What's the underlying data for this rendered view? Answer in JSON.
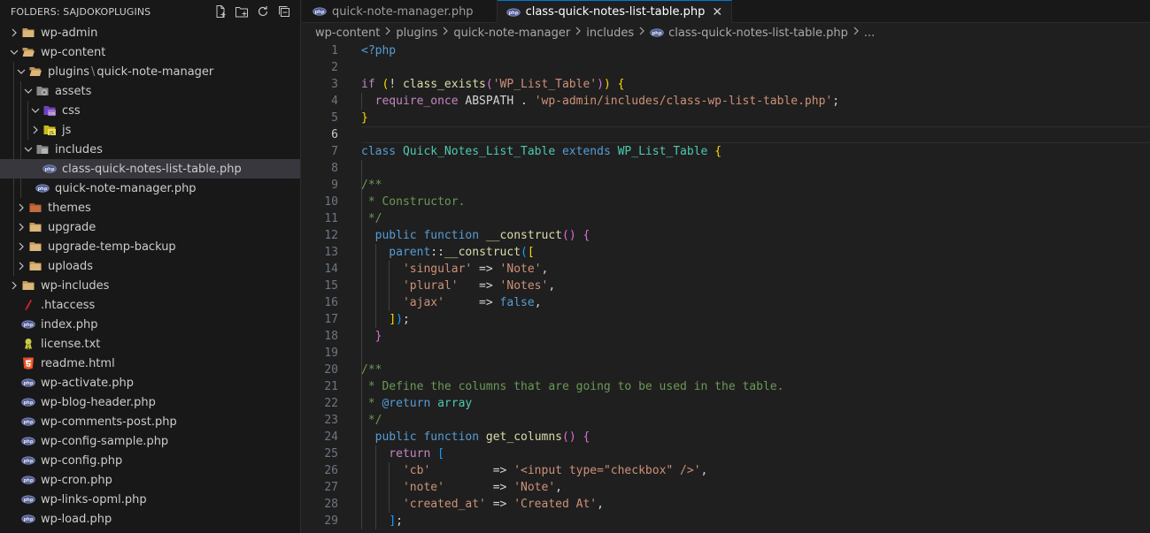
{
  "sidebar": {
    "title": "FOLDERS: SAJDOKOPLUGINS",
    "actions": [
      "new-file-icon",
      "new-folder-icon",
      "refresh-icon",
      "collapse-all-icon"
    ],
    "tree": [
      {
        "label": "wp-admin",
        "depth": 0,
        "type": "folder",
        "expanded": false,
        "icon": "folder-icon"
      },
      {
        "label": "wp-content",
        "depth": 0,
        "type": "folder",
        "expanded": true,
        "icon": "folder-open-icon"
      },
      {
        "label": "plugins",
        "label2": "quick-note-manager",
        "depth": 1,
        "type": "folder",
        "expanded": true,
        "icon": "folder-open-icon"
      },
      {
        "label": "assets",
        "depth": 2,
        "type": "folder",
        "expanded": true,
        "icon": "assets-folder-icon"
      },
      {
        "label": "css",
        "depth": 3,
        "type": "folder",
        "expanded": true,
        "icon": "css-folder-icon"
      },
      {
        "label": "js",
        "depth": 3,
        "type": "folder",
        "expanded": false,
        "icon": "js-folder-icon"
      },
      {
        "label": "includes",
        "depth": 2,
        "type": "folder",
        "expanded": true,
        "icon": "includes-folder-icon"
      },
      {
        "label": "class-quick-notes-list-table.php",
        "depth": 3,
        "type": "php",
        "selected": true,
        "icon": "php-file-icon"
      },
      {
        "label": "quick-note-manager.php",
        "depth": 2,
        "type": "php",
        "icon": "php-file-icon"
      },
      {
        "label": "themes",
        "depth": 1,
        "type": "folder",
        "expanded": false,
        "icon": "themes-folder-icon"
      },
      {
        "label": "upgrade",
        "depth": 1,
        "type": "folder",
        "expanded": false,
        "icon": "folder-icon"
      },
      {
        "label": "upgrade-temp-backup",
        "depth": 1,
        "type": "folder",
        "expanded": false,
        "icon": "folder-icon"
      },
      {
        "label": "uploads",
        "depth": 1,
        "type": "folder",
        "expanded": false,
        "icon": "folder-icon"
      },
      {
        "label": "wp-includes",
        "depth": 0,
        "type": "folder",
        "expanded": false,
        "icon": "folder-icon"
      },
      {
        "label": ".htaccess",
        "depth": 0,
        "type": "htaccess",
        "icon": "htaccess-icon"
      },
      {
        "label": "index.php",
        "depth": 0,
        "type": "php",
        "icon": "php-file-icon"
      },
      {
        "label": "license.txt",
        "depth": 0,
        "type": "txt",
        "icon": "license-icon"
      },
      {
        "label": "readme.html",
        "depth": 0,
        "type": "html",
        "icon": "html5-icon"
      },
      {
        "label": "wp-activate.php",
        "depth": 0,
        "type": "php",
        "icon": "php-file-icon"
      },
      {
        "label": "wp-blog-header.php",
        "depth": 0,
        "type": "php",
        "icon": "php-file-icon"
      },
      {
        "label": "wp-comments-post.php",
        "depth": 0,
        "type": "php",
        "icon": "php-file-icon"
      },
      {
        "label": "wp-config-sample.php",
        "depth": 0,
        "type": "php",
        "icon": "php-file-icon"
      },
      {
        "label": "wp-config.php",
        "depth": 0,
        "type": "php",
        "icon": "php-file-icon"
      },
      {
        "label": "wp-cron.php",
        "depth": 0,
        "type": "php",
        "icon": "php-file-icon"
      },
      {
        "label": "wp-links-opml.php",
        "depth": 0,
        "type": "php",
        "icon": "php-file-icon"
      },
      {
        "label": "wp-load.php",
        "depth": 0,
        "type": "php",
        "icon": "php-file-icon"
      }
    ]
  },
  "tabs": [
    {
      "label": "quick-note-manager.php",
      "active": false
    },
    {
      "label": "class-quick-notes-list-table.php",
      "active": true,
      "close": "✕"
    }
  ],
  "breadcrumb": [
    "wp-content",
    "plugins",
    "quick-note-manager",
    "includes",
    "class-quick-notes-list-table.php",
    "..."
  ],
  "editor": {
    "current_line": 6,
    "lines": [
      {
        "n": "1",
        "ind": 0,
        "t": [
          [
            "<?php",
            "tag"
          ]
        ]
      },
      {
        "n": "2",
        "ind": 0,
        "t": []
      },
      {
        "n": "3",
        "ind": 0,
        "t": [
          [
            "if ",
            "kw"
          ],
          [
            "(",
            "br1"
          ],
          [
            "! ",
            "op"
          ],
          [
            "class_exists",
            "fn"
          ],
          [
            "(",
            "br2"
          ],
          [
            "'WP_List_Table'",
            "str"
          ],
          [
            ")",
            "br2"
          ],
          [
            ")",
            "br1"
          ],
          [
            " ",
            "op"
          ],
          [
            "{",
            "br1"
          ]
        ]
      },
      {
        "n": "4",
        "ind": 1,
        "t": [
          [
            "  require_once ",
            "kw"
          ],
          [
            "ABSPATH . ",
            "const"
          ],
          [
            "'wp-admin/includes/class-wp-list-table.php'",
            "str"
          ],
          [
            ";",
            "op"
          ]
        ]
      },
      {
        "n": "5",
        "ind": 0,
        "t": [
          [
            "}",
            "br1"
          ]
        ]
      },
      {
        "n": "6",
        "ind": 0,
        "t": []
      },
      {
        "n": "7",
        "ind": 0,
        "t": [
          [
            "class ",
            "kw2"
          ],
          [
            "Quick_Notes_List_Table ",
            "cls"
          ],
          [
            "extends ",
            "kw2"
          ],
          [
            "WP_List_Table ",
            "cls"
          ],
          [
            "{",
            "br1"
          ]
        ]
      },
      {
        "n": "8",
        "ind": 1,
        "t": []
      },
      {
        "n": "9",
        "ind": 1,
        "t": [
          [
            "/**",
            "cmt"
          ]
        ]
      },
      {
        "n": "10",
        "ind": 1,
        "t": [
          [
            " * Constructor.",
            "cmt"
          ]
        ]
      },
      {
        "n": "11",
        "ind": 1,
        "t": [
          [
            " */",
            "cmt"
          ]
        ]
      },
      {
        "n": "12",
        "ind": 1,
        "t": [
          [
            "  public ",
            "kw2"
          ],
          [
            "function ",
            "kw2"
          ],
          [
            "__construct",
            "fn"
          ],
          [
            "(",
            "br2"
          ],
          [
            ")",
            "br2"
          ],
          [
            " ",
            "op"
          ],
          [
            "{",
            "br2"
          ]
        ]
      },
      {
        "n": "13",
        "ind": 2,
        "t": [
          [
            "    parent",
            "kw2"
          ],
          [
            "::",
            "op"
          ],
          [
            "__construct",
            "fn"
          ],
          [
            "(",
            "br3"
          ],
          [
            "[",
            "br1"
          ]
        ]
      },
      {
        "n": "14",
        "ind": 3,
        "t": [
          [
            "      'singular'",
            "str"
          ],
          [
            " => ",
            "op"
          ],
          [
            "'Note'",
            "str"
          ],
          [
            ",",
            "op"
          ]
        ]
      },
      {
        "n": "15",
        "ind": 3,
        "t": [
          [
            "      'plural'",
            "str"
          ],
          [
            "   => ",
            "op"
          ],
          [
            "'Notes'",
            "str"
          ],
          [
            ",",
            "op"
          ]
        ]
      },
      {
        "n": "16",
        "ind": 3,
        "t": [
          [
            "      'ajax'",
            "str"
          ],
          [
            "     => ",
            "op"
          ],
          [
            "false",
            "bool"
          ],
          [
            ",",
            "op"
          ]
        ]
      },
      {
        "n": "17",
        "ind": 2,
        "t": [
          [
            "    ",
            "op"
          ],
          [
            "]",
            "br1"
          ],
          [
            ")",
            "br3"
          ],
          [
            ";",
            "op"
          ]
        ]
      },
      {
        "n": "18",
        "ind": 1,
        "t": [
          [
            "  ",
            "op"
          ],
          [
            "}",
            "br2"
          ]
        ]
      },
      {
        "n": "19",
        "ind": 1,
        "t": []
      },
      {
        "n": "20",
        "ind": 1,
        "t": [
          [
            "/**",
            "cmt"
          ]
        ]
      },
      {
        "n": "21",
        "ind": 1,
        "t": [
          [
            " * Define the columns that are going to be used in the table.",
            "cmt"
          ]
        ]
      },
      {
        "n": "22",
        "ind": 1,
        "t": [
          [
            " * ",
            "cmt"
          ],
          [
            "@return",
            "cmtdoc"
          ],
          [
            " ",
            "cmt"
          ],
          [
            "array",
            "cls"
          ]
        ]
      },
      {
        "n": "23",
        "ind": 1,
        "t": [
          [
            " */",
            "cmt"
          ]
        ]
      },
      {
        "n": "24",
        "ind": 1,
        "t": [
          [
            "  public ",
            "kw2"
          ],
          [
            "function ",
            "kw2"
          ],
          [
            "get_columns",
            "fn"
          ],
          [
            "(",
            "br2"
          ],
          [
            ")",
            "br2"
          ],
          [
            " ",
            "op"
          ],
          [
            "{",
            "br2"
          ]
        ]
      },
      {
        "n": "25",
        "ind": 2,
        "t": [
          [
            "    return ",
            "kw"
          ],
          [
            "[",
            "br3"
          ]
        ]
      },
      {
        "n": "26",
        "ind": 3,
        "t": [
          [
            "      'cb'",
            "str"
          ],
          [
            "         => ",
            "op"
          ],
          [
            "'<input type=\"checkbox\" />'",
            "str"
          ],
          [
            ",",
            "op"
          ]
        ]
      },
      {
        "n": "27",
        "ind": 3,
        "t": [
          [
            "      'note'",
            "str"
          ],
          [
            "       => ",
            "op"
          ],
          [
            "'Note'",
            "str"
          ],
          [
            ",",
            "op"
          ]
        ]
      },
      {
        "n": "28",
        "ind": 3,
        "t": [
          [
            "      'created_at'",
            "str"
          ],
          [
            " => ",
            "op"
          ],
          [
            "'Created At'",
            "str"
          ],
          [
            ",",
            "op"
          ]
        ]
      },
      {
        "n": "29",
        "ind": 2,
        "t": [
          [
            "    ",
            "op"
          ],
          [
            "]",
            "br3"
          ],
          [
            ";",
            "op"
          ]
        ]
      }
    ]
  }
}
